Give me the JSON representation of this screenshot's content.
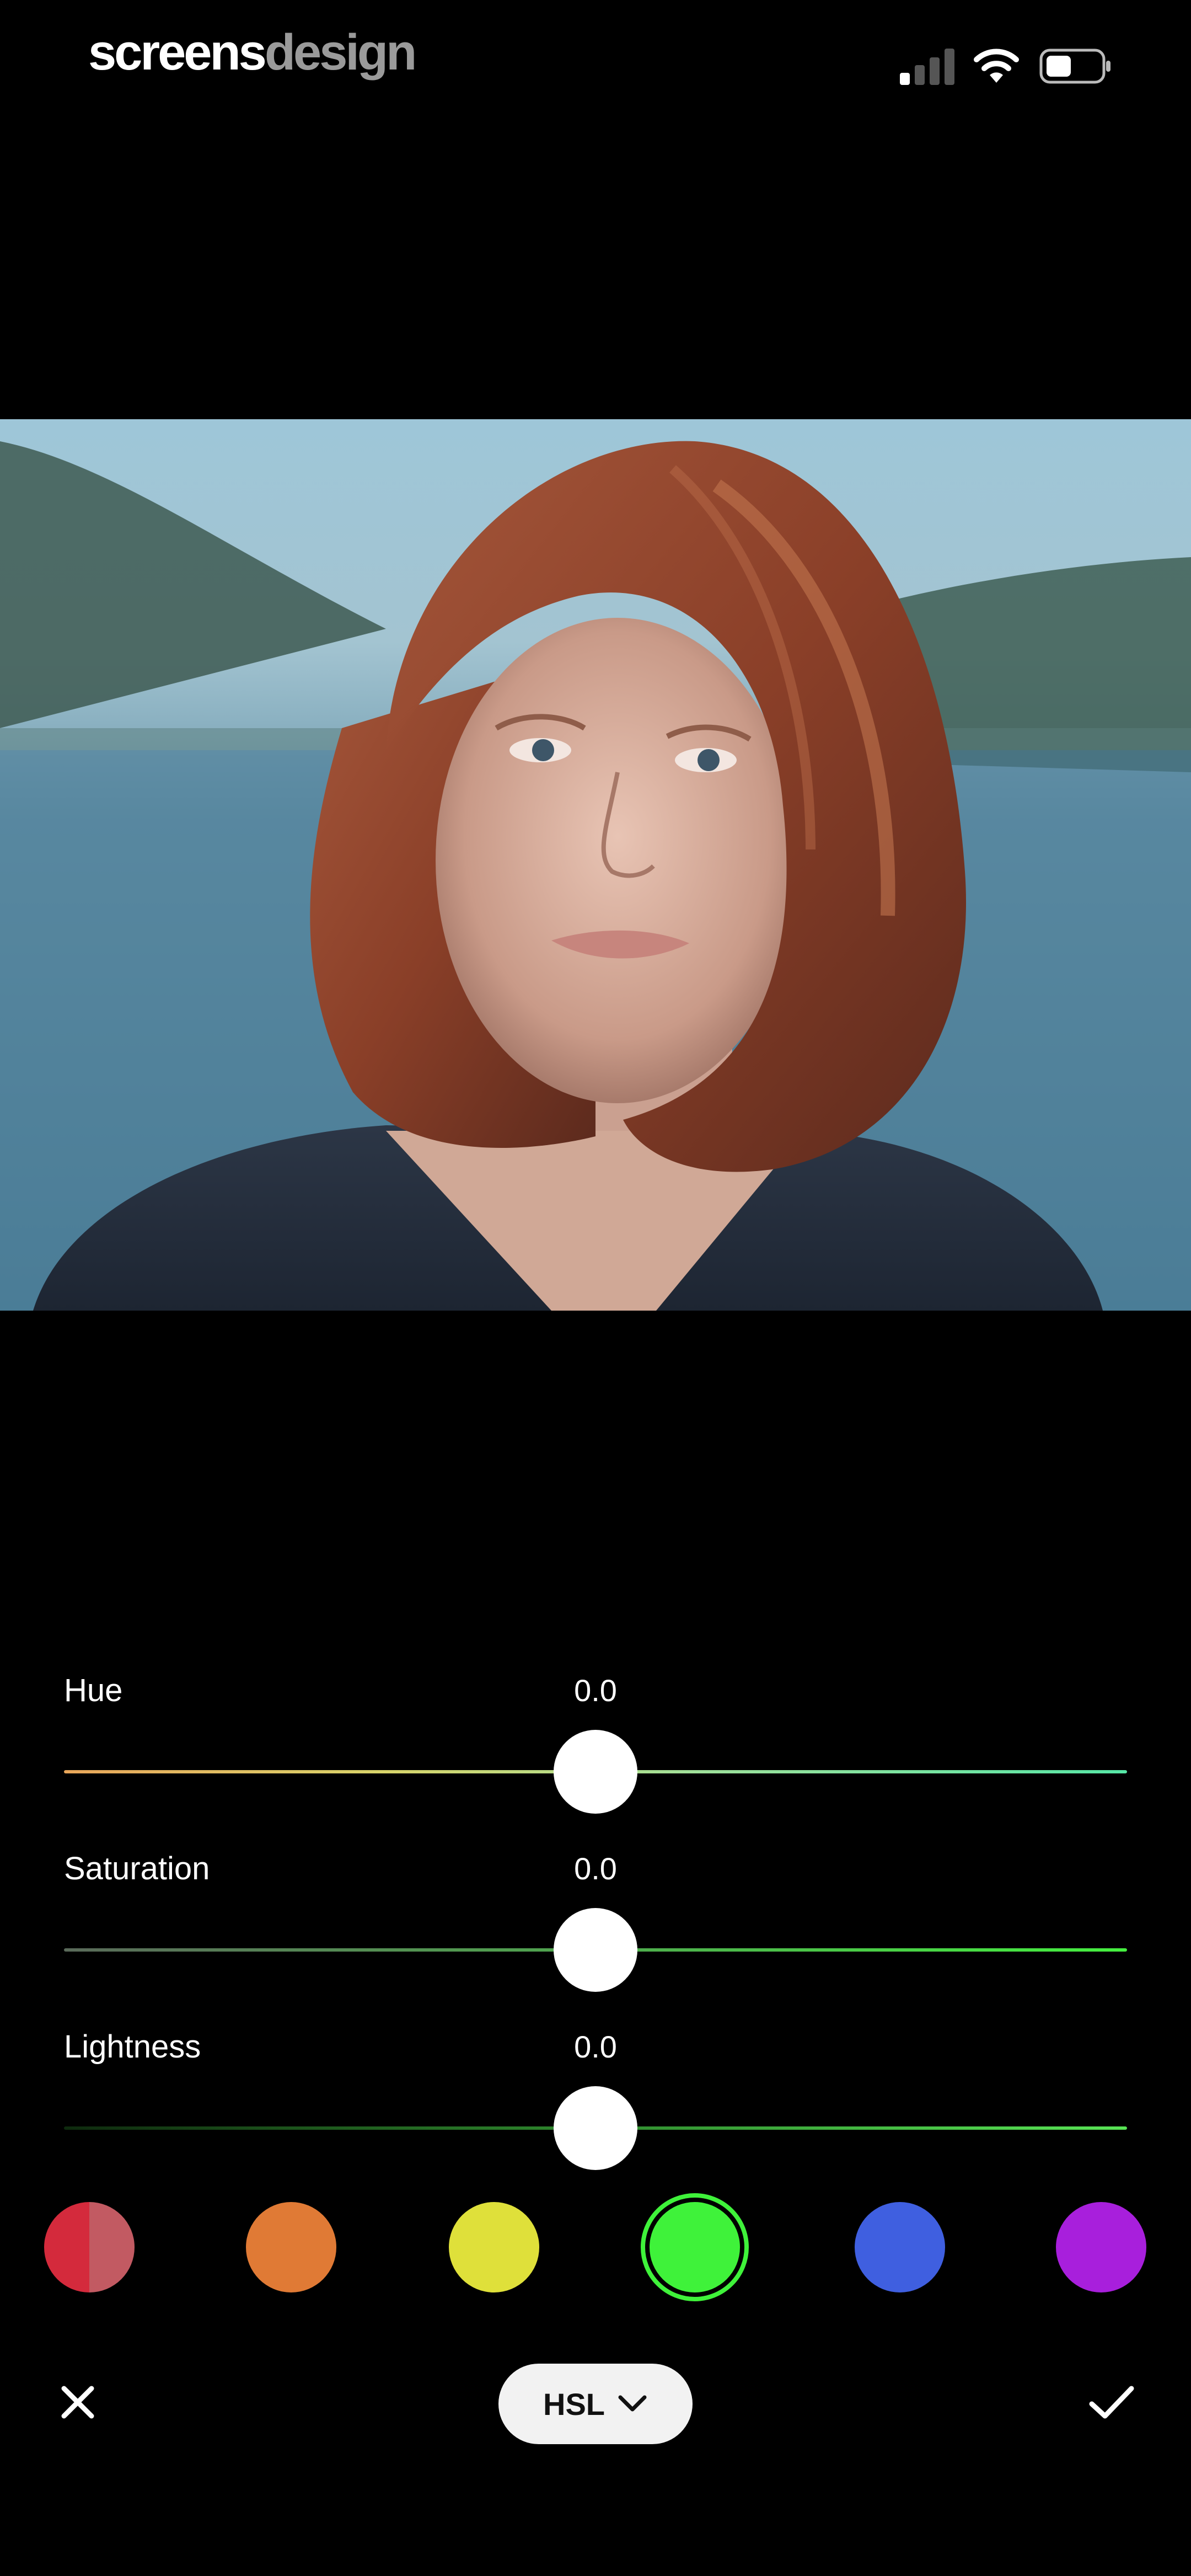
{
  "status_bar": {
    "brand_primary": "screens",
    "brand_secondary": "design",
    "signal_icon": "cellular-signal-icon",
    "wifi_icon": "wifi-icon",
    "battery_icon": "battery-icon"
  },
  "photo": {
    "description_icon": "portrait-photo"
  },
  "adjustments": {
    "hue": {
      "label": "Hue",
      "value": "0.0"
    },
    "saturation": {
      "label": "Saturation",
      "value": "0.0"
    },
    "lightness": {
      "label": "Lightness",
      "value": "0.0"
    }
  },
  "swatches": [
    {
      "name": "red",
      "color": "#d42a3c"
    },
    {
      "name": "orange",
      "color": "#e07a35"
    },
    {
      "name": "yellow",
      "color": "#dfe03a"
    },
    {
      "name": "green",
      "color": "#3ff23a",
      "selected": true
    },
    {
      "name": "blue",
      "color": "#3f5fe0"
    },
    {
      "name": "purple",
      "color": "#a81fdc"
    }
  ],
  "bottom_bar": {
    "close_icon": "close-icon",
    "mode_label": "HSL",
    "mode_icon": "chevron-down-icon",
    "confirm_icon": "checkmark-icon"
  }
}
